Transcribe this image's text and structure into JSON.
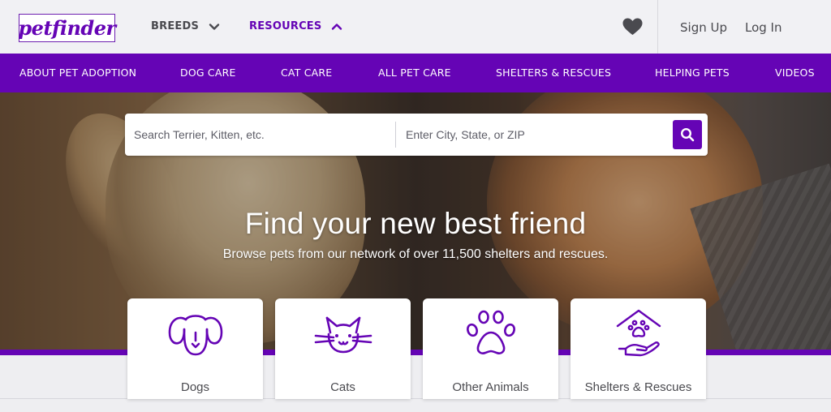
{
  "header": {
    "logo_text": "petfinder",
    "nav": [
      {
        "label": "BREEDS",
        "icon": "chevron-down-icon"
      },
      {
        "label": "RESOURCES",
        "icon": "chevron-up-icon"
      }
    ],
    "favorites_icon": "heart-icon",
    "sign_up": "Sign Up",
    "log_in": "Log In"
  },
  "subnav": {
    "items": [
      "ABOUT PET ADOPTION",
      "DOG CARE",
      "CAT CARE",
      "ALL PET CARE",
      "SHELTERS & RESCUES",
      "HELPING PETS",
      "VIDEOS"
    ]
  },
  "search": {
    "pet_placeholder": "Search Terrier, Kitten, etc.",
    "location_placeholder": "Enter City, State, or ZIP",
    "button_icon": "search-icon"
  },
  "hero": {
    "title": "Find your new best friend",
    "subtitle": "Browse pets from our network of over 11,500 shelters and rescues."
  },
  "categories": [
    {
      "label": "Dogs",
      "icon": "dog-icon"
    },
    {
      "label": "Cats",
      "icon": "cat-icon"
    },
    {
      "label": "Other Animals",
      "icon": "paw-icon"
    },
    {
      "label": "Shelters & Rescues",
      "icon": "shelter-icon"
    }
  ],
  "colors": {
    "brand_purple": "#6504b5",
    "header_bg": "#f1f1f4",
    "text_gray": "#4a4a4f"
  }
}
